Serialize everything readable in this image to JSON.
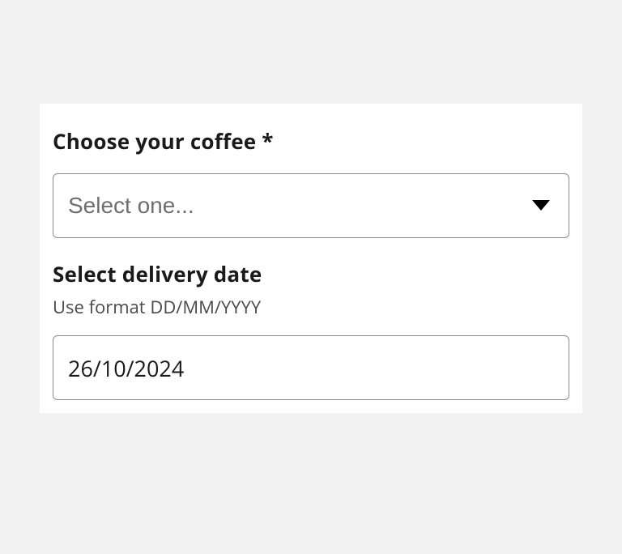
{
  "form": {
    "coffee": {
      "label": "Choose your coffee *",
      "placeholder": "Select one..."
    },
    "delivery": {
      "label": "Select delivery date",
      "hint": "Use format DD/MM/YYYY",
      "value": "26/10/2024"
    }
  }
}
